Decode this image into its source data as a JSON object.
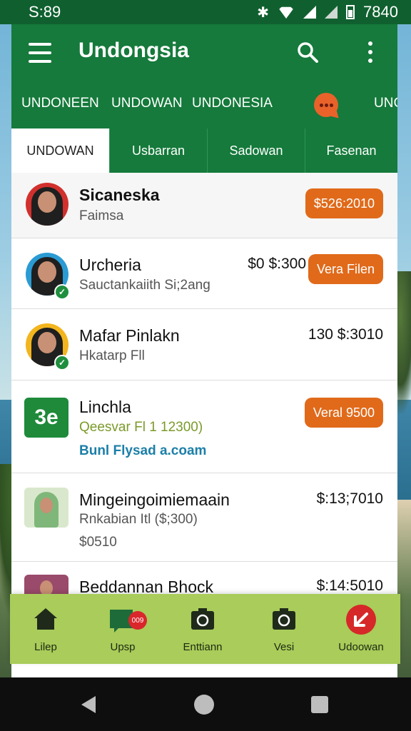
{
  "status_bar": {
    "time": "S:89",
    "right_text": "7840"
  },
  "app_bar": {
    "title": "Undongsia",
    "top_tabs": [
      "UNDONEEN",
      "UNDOWAN",
      "UNDONESIA",
      "UNC"
    ]
  },
  "segment_tabs": [
    "UNDOWAN",
    "Usbarran",
    "Sadowan",
    "Fasenan"
  ],
  "list": [
    {
      "name": "Sicaneska",
      "subtitle": "Faimsa",
      "pill": "$526:2010"
    },
    {
      "name": "Urcheria",
      "subtitle": "Sauctankaiith Si;2ang",
      "price": "$0 $:300",
      "pill": "Vera Filen"
    },
    {
      "name": "Mafar Pinlakn",
      "subtitle": "Hkatarp Fll",
      "price": "130 $:3010"
    },
    {
      "name": "Linchla",
      "logo_text": "3e",
      "subtitle": "Qeesvar Fl 1 12300)",
      "link": "Bunl Flysad a.coam",
      "pill": "Veral 9500"
    },
    {
      "name": "Mingeingoimiemaain",
      "subtitle": "Rnkabian Itl ($;300)",
      "extra": "$0510",
      "price": "$:13;7010"
    },
    {
      "name": "Beddannan Bhock",
      "price": "$:14:5010"
    }
  ],
  "bottom_nav": [
    {
      "label": "Lilep",
      "icon": "home-icon"
    },
    {
      "label": "Upsp",
      "icon": "chat-icon",
      "badge": "009"
    },
    {
      "label": "Enttiann",
      "icon": "camera-icon"
    },
    {
      "label": "Vesi",
      "icon": "camera-icon"
    },
    {
      "label": "Udoowan",
      "icon": "arrow-down-left-icon"
    }
  ],
  "colors": {
    "primary": "#157a3b",
    "accent": "#e06a1a",
    "bottom_nav": "#a9cc5a",
    "link": "#1b7fa8",
    "subtitle_green": "#7a9a2a"
  }
}
